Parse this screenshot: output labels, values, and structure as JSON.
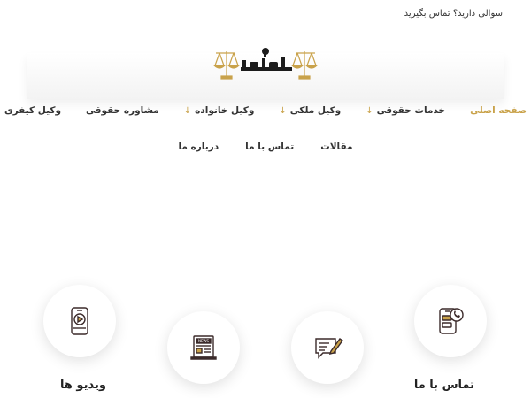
{
  "topbar": {
    "contact_text": "سوالی دارید؟ تماس بگیرید"
  },
  "logo": {
    "text": "عدل و حق"
  },
  "nav": {
    "row1": [
      {
        "label": "صفحه اصلی",
        "has_submenu": false,
        "active": true
      },
      {
        "label": "خدمات حقوقی",
        "has_submenu": true
      },
      {
        "label": "وکیل ملکی",
        "has_submenu": true
      },
      {
        "label": "وکیل خانواده",
        "has_submenu": true
      },
      {
        "label": "مشاوره حقوقی",
        "has_submenu": false
      },
      {
        "label": "وکیل کیفری",
        "has_submenu": false
      }
    ],
    "row2": [
      {
        "label": "مقالات"
      },
      {
        "label": "تماس با ما"
      },
      {
        "label": "درباره ما"
      }
    ],
    "arrow_glyph": "↓"
  },
  "features": [
    {
      "title": "تماس با ما",
      "icon": "phone-chat-icon"
    },
    {
      "title": "",
      "icon": "chat-pen-icon"
    },
    {
      "title": "",
      "icon": "news-icon"
    },
    {
      "title": "ویدیو ها",
      "icon": "video-phone-icon"
    }
  ],
  "colors": {
    "accent": "#c9a24a",
    "icon_stroke": "#3b2a2a",
    "text": "#333333"
  }
}
